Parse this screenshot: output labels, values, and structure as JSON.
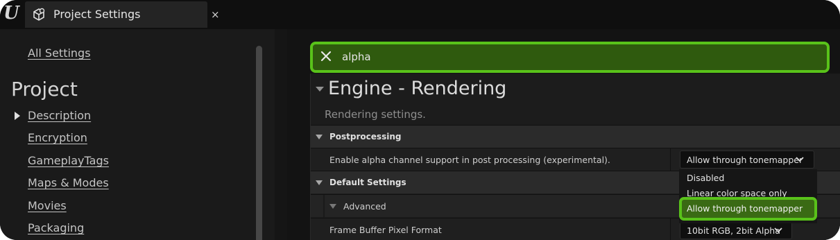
{
  "window": {
    "tab_title": "Project Settings",
    "tab_close": "×",
    "logo": "U"
  },
  "sidebar": {
    "all_settings": "All Settings",
    "section_title": "Project",
    "items": [
      {
        "label": "Description",
        "selected": true
      },
      {
        "label": "Encryption"
      },
      {
        "label": "GameplayTags"
      },
      {
        "label": "Maps & Modes"
      },
      {
        "label": "Movies"
      },
      {
        "label": "Packaging"
      }
    ]
  },
  "search": {
    "value": "alpha",
    "clear_icon": "close-icon",
    "highlight_color": "#59c21a"
  },
  "details": {
    "category_title": "Engine - Rendering",
    "category_description": "Rendering settings.",
    "groups": {
      "postprocessing": "Postprocessing",
      "default_settings": "Default Settings",
      "advanced": "Advanced"
    },
    "properties": {
      "alpha_channel_label": "Enable alpha channel support in post processing (experimental).",
      "alpha_channel_value": "Allow through tonemapper",
      "frame_buffer_label": "Frame Buffer Pixel Format",
      "frame_buffer_value": "10bit RGB, 2bit Alpha"
    },
    "dropdown_options": [
      "Disabled",
      "Linear color space only",
      "Allow through tonemapper"
    ],
    "dropdown_selected": "Allow through tonemapper"
  }
}
